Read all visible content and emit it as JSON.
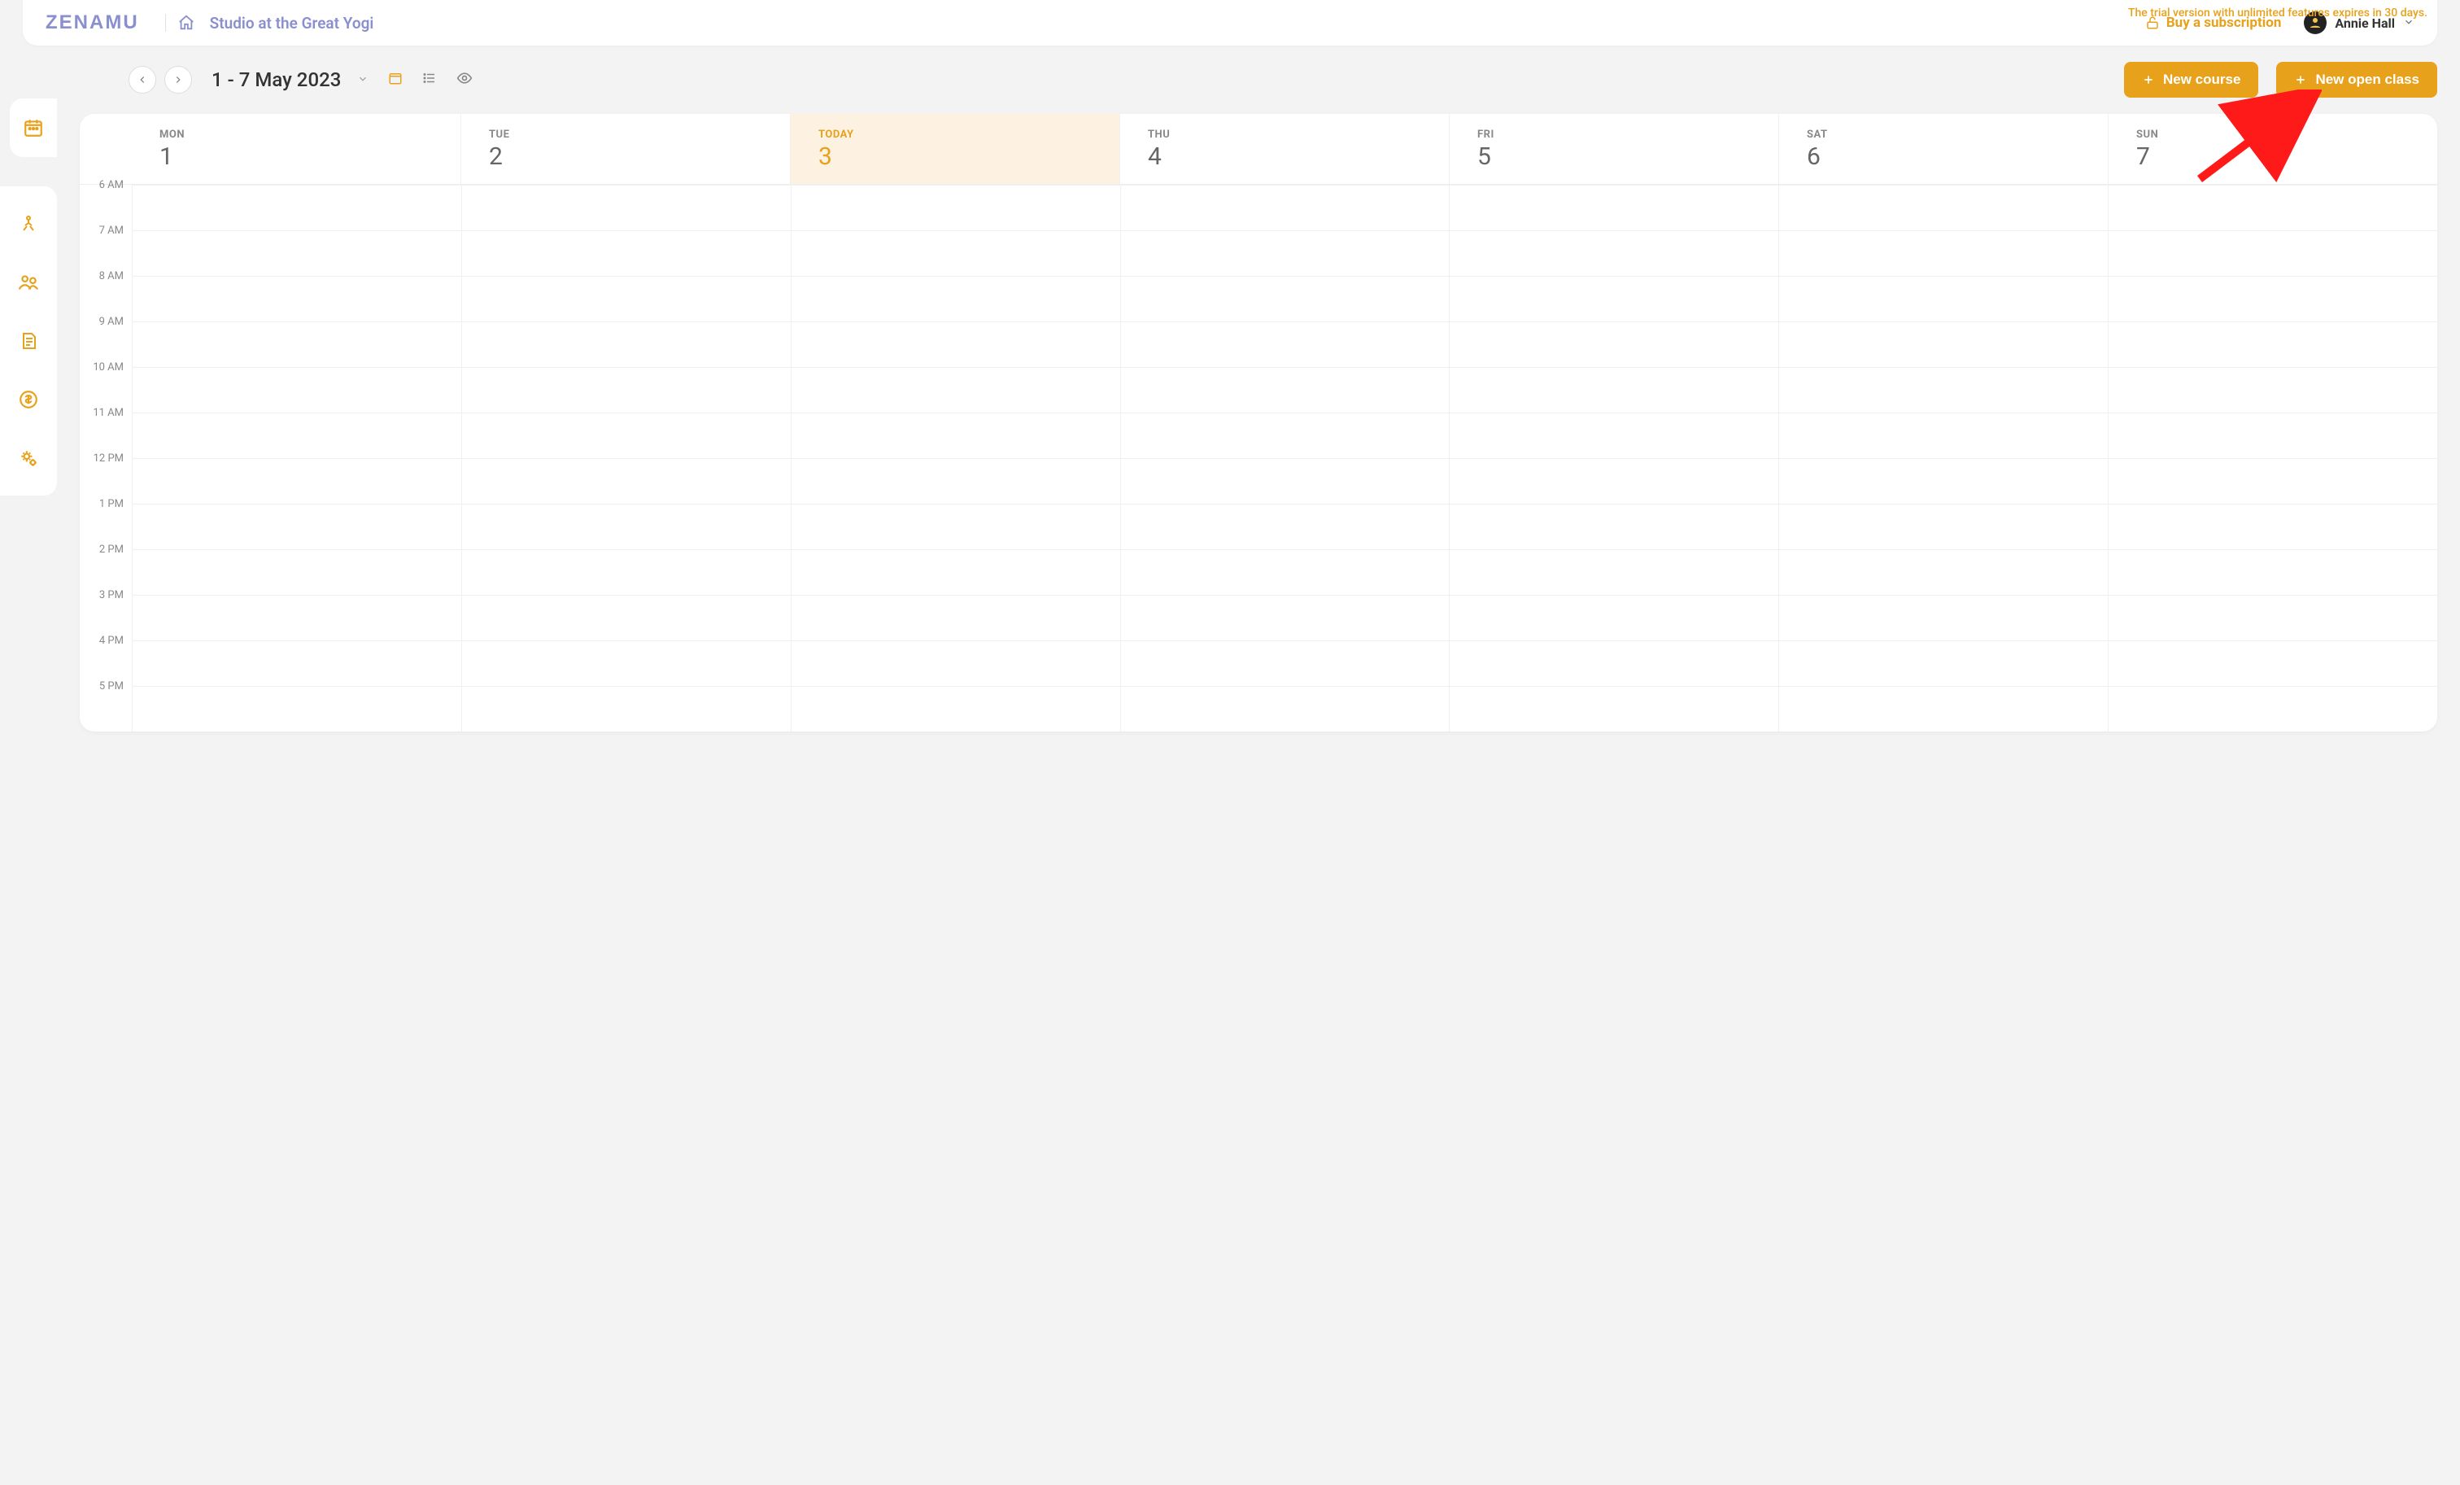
{
  "header": {
    "logo": "ZENAMU",
    "studio_name": "Studio at the Great Yogi",
    "trial_notice": "The trial version with unlimited features expires in 30 days.",
    "subscription_link": "Buy a subscription",
    "user_name": "Annie Hall"
  },
  "sidebar": {
    "icons": [
      "calendar",
      "yoga",
      "people",
      "notes",
      "money",
      "settings"
    ]
  },
  "toolbar": {
    "date_range": "1 - 7 May 2023",
    "new_course": "New course",
    "new_open_class": "New open class"
  },
  "calendar": {
    "days": [
      {
        "label": "MON",
        "num": "1",
        "today": false
      },
      {
        "label": "TUE",
        "num": "2",
        "today": false
      },
      {
        "label": "TODAY",
        "num": "3",
        "today": true
      },
      {
        "label": "THU",
        "num": "4",
        "today": false
      },
      {
        "label": "FRI",
        "num": "5",
        "today": false
      },
      {
        "label": "SAT",
        "num": "6",
        "today": false
      },
      {
        "label": "SUN",
        "num": "7",
        "today": false
      }
    ],
    "time_slots": [
      "6 AM",
      "7 AM",
      "8 AM",
      "9 AM",
      "10 AM",
      "11 AM",
      "12 PM",
      "1 PM",
      "2 PM",
      "3 PM",
      "4 PM",
      "5 PM"
    ]
  },
  "colors": {
    "accent": "#e8a11a",
    "brand": "#8a8fce"
  }
}
